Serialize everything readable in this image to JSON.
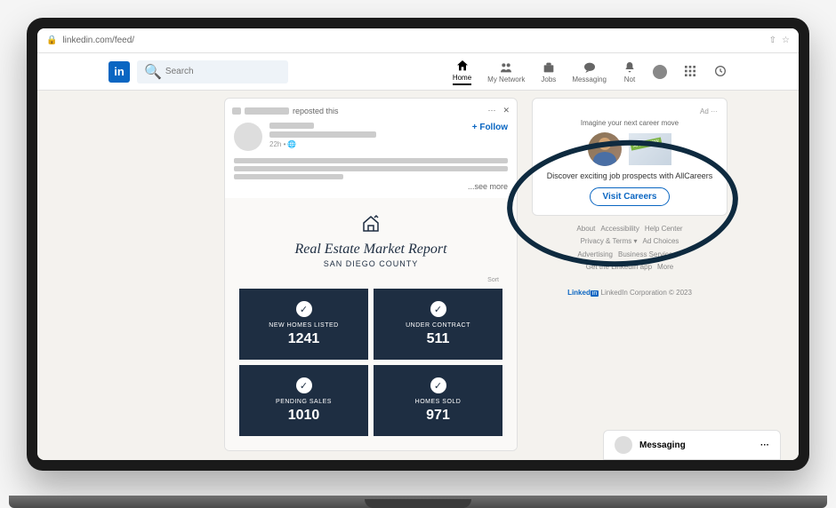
{
  "url": "linkedin.com/feed/",
  "search": {
    "placeholder": "Search"
  },
  "nav": {
    "home": "Home",
    "network": "My Network",
    "jobs": "Jobs",
    "msg": "Messaging",
    "notif": "Not",
    "work": "",
    "learn": ""
  },
  "post": {
    "repost_suffix": "reposted this",
    "timestamp": "22h • ",
    "follow": "+ Follow",
    "seemore": "...see more"
  },
  "report": {
    "title": "Real Estate Market Report",
    "subtitle": "SAN DIEGO COUNTY",
    "sort": "Sort",
    "stats": [
      {
        "label": "NEW HOMES LISTED",
        "value": "1241"
      },
      {
        "label": "UNDER CONTRACT",
        "value": "511"
      },
      {
        "label": "PENDING SALES",
        "value": "1010"
      },
      {
        "label": "HOMES SOLD",
        "value": "971"
      }
    ]
  },
  "ad": {
    "label": "Ad ···",
    "title": "Imagine your next career move",
    "desc": "Discover exciting job prospects with AllCareers",
    "button": "Visit Careers"
  },
  "footer": {
    "links": [
      "About",
      "Accessibility",
      "Help Center",
      "Privacy & Terms ▾",
      "Ad Choices",
      "Advertising",
      "Business Services ▾",
      "Get the LinkedIn app",
      "More"
    ],
    "copyright": "LinkedIn Corporation © 2023",
    "brand": "Linked"
  },
  "messaging": "Messaging"
}
